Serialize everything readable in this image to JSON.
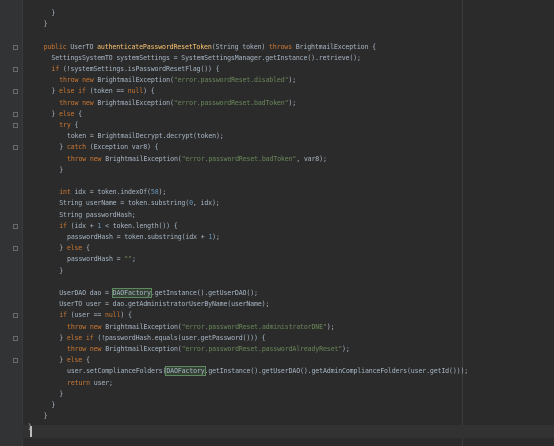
{
  "editor": {
    "background": "#2b2b2b",
    "language": "java",
    "lines": [
      {
        "indent": 6,
        "tokens": [
          {
            "t": "}",
            "c": "p"
          }
        ]
      },
      {
        "indent": 4,
        "tokens": [
          {
            "t": "}",
            "c": "p"
          }
        ]
      },
      {
        "indent": 0,
        "tokens": []
      },
      {
        "indent": 4,
        "tokens": [
          {
            "t": "public ",
            "c": "kw"
          },
          {
            "t": "UserTO ",
            "c": "p"
          },
          {
            "t": "authenticatePasswordResetToken",
            "c": "fn"
          },
          {
            "t": "(String token) ",
            "c": "p"
          },
          {
            "t": "throws ",
            "c": "kw"
          },
          {
            "t": "BrightmailException {",
            "c": "p"
          }
        ]
      },
      {
        "indent": 6,
        "tokens": [
          {
            "t": "SettingsSystemTO systemSettings = SystemSettingsManager.getInstance().retrieve();",
            "c": "p"
          }
        ]
      },
      {
        "indent": 6,
        "tokens": [
          {
            "t": "if ",
            "c": "kw"
          },
          {
            "t": "(!systemSettings.isPasswordResetFlag()) {",
            "c": "p"
          }
        ]
      },
      {
        "indent": 8,
        "tokens": [
          {
            "t": "throw new ",
            "c": "kw"
          },
          {
            "t": "BrightmailException(",
            "c": "p"
          },
          {
            "t": "\"error.passwordReset.disabled\"",
            "c": "str"
          },
          {
            "t": ");",
            "c": "p"
          }
        ]
      },
      {
        "indent": 6,
        "tokens": [
          {
            "t": "} ",
            "c": "p"
          },
          {
            "t": "else if ",
            "c": "kw"
          },
          {
            "t": "(token == ",
            "c": "p"
          },
          {
            "t": "null",
            "c": "kw"
          },
          {
            "t": ") {",
            "c": "p"
          }
        ]
      },
      {
        "indent": 8,
        "tokens": [
          {
            "t": "throw new ",
            "c": "kw"
          },
          {
            "t": "BrightmailException(",
            "c": "p"
          },
          {
            "t": "\"error.passwordReset.badToken\"",
            "c": "str"
          },
          {
            "t": ");",
            "c": "p"
          }
        ]
      },
      {
        "indent": 6,
        "tokens": [
          {
            "t": "} ",
            "c": "p"
          },
          {
            "t": "else ",
            "c": "kw"
          },
          {
            "t": "{",
            "c": "p"
          }
        ]
      },
      {
        "indent": 8,
        "tokens": [
          {
            "t": "try ",
            "c": "kw"
          },
          {
            "t": "{",
            "c": "p"
          }
        ]
      },
      {
        "indent": 10,
        "tokens": [
          {
            "t": "token = BrightmailDecrypt.decrypt(token);",
            "c": "p"
          }
        ]
      },
      {
        "indent": 8,
        "tokens": [
          {
            "t": "} ",
            "c": "p"
          },
          {
            "t": "catch ",
            "c": "kw"
          },
          {
            "t": "(Exception var8) {",
            "c": "p"
          }
        ]
      },
      {
        "indent": 10,
        "tokens": [
          {
            "t": "throw new ",
            "c": "kw"
          },
          {
            "t": "BrightmailException(",
            "c": "p"
          },
          {
            "t": "\"error.passwordReset.badToken\"",
            "c": "str"
          },
          {
            "t": ", var8);",
            "c": "p"
          }
        ]
      },
      {
        "indent": 8,
        "tokens": [
          {
            "t": "}",
            "c": "p"
          }
        ]
      },
      {
        "indent": 0,
        "tokens": []
      },
      {
        "indent": 8,
        "tokens": [
          {
            "t": "int ",
            "c": "kw"
          },
          {
            "t": "idx = token.indexOf(",
            "c": "p"
          },
          {
            "t": "58",
            "c": "num"
          },
          {
            "t": ");",
            "c": "p"
          }
        ]
      },
      {
        "indent": 8,
        "tokens": [
          {
            "t": "String userName = token.substring(",
            "c": "p"
          },
          {
            "t": "0",
            "c": "num"
          },
          {
            "t": ", idx);",
            "c": "p"
          }
        ]
      },
      {
        "indent": 8,
        "tokens": [
          {
            "t": "String passwordHash;",
            "c": "p"
          }
        ]
      },
      {
        "indent": 8,
        "tokens": [
          {
            "t": "if ",
            "c": "kw"
          },
          {
            "t": "(idx + ",
            "c": "p"
          },
          {
            "t": "1",
            "c": "num"
          },
          {
            "t": " < token.length()) {",
            "c": "p"
          }
        ]
      },
      {
        "indent": 10,
        "tokens": [
          {
            "t": "passwordHash = token.substring(idx + ",
            "c": "p"
          },
          {
            "t": "1",
            "c": "num"
          },
          {
            "t": ");",
            "c": "p"
          }
        ]
      },
      {
        "indent": 8,
        "tokens": [
          {
            "t": "} ",
            "c": "p"
          },
          {
            "t": "else ",
            "c": "kw"
          },
          {
            "t": "{",
            "c": "p"
          }
        ]
      },
      {
        "indent": 10,
        "tokens": [
          {
            "t": "passwordHash = ",
            "c": "p"
          },
          {
            "t": "\"\"",
            "c": "str"
          },
          {
            "t": ";",
            "c": "p"
          }
        ]
      },
      {
        "indent": 8,
        "tokens": [
          {
            "t": "}",
            "c": "p"
          }
        ]
      },
      {
        "indent": 0,
        "tokens": []
      },
      {
        "indent": 8,
        "tokens": [
          {
            "t": "UserDAO dao = ",
            "c": "p"
          },
          {
            "t": "DAOFactory",
            "c": "hl"
          },
          {
            "t": ".getInstance().getUserDAO();",
            "c": "p"
          }
        ]
      },
      {
        "indent": 8,
        "tokens": [
          {
            "t": "UserTO user = dao.getAdministratorUserByName(userName);",
            "c": "p"
          }
        ]
      },
      {
        "indent": 8,
        "tokens": [
          {
            "t": "if ",
            "c": "kw"
          },
          {
            "t": "(user == ",
            "c": "p"
          },
          {
            "t": "null",
            "c": "kw"
          },
          {
            "t": ") {",
            "c": "p"
          }
        ]
      },
      {
        "indent": 10,
        "tokens": [
          {
            "t": "throw new ",
            "c": "kw"
          },
          {
            "t": "BrightmailException(",
            "c": "p"
          },
          {
            "t": "\"error.passwordReset.administratorDNE\"",
            "c": "str"
          },
          {
            "t": ");",
            "c": "p"
          }
        ]
      },
      {
        "indent": 8,
        "tokens": [
          {
            "t": "} ",
            "c": "p"
          },
          {
            "t": "else if ",
            "c": "kw"
          },
          {
            "t": "(!passwordHash.equals(user.getPassword())) {",
            "c": "p"
          }
        ]
      },
      {
        "indent": 10,
        "tokens": [
          {
            "t": "throw new ",
            "c": "kw"
          },
          {
            "t": "BrightmailException(",
            "c": "p"
          },
          {
            "t": "\"error.passwordReset.passwordAlreadyReset\"",
            "c": "str"
          },
          {
            "t": ");",
            "c": "p"
          }
        ]
      },
      {
        "indent": 8,
        "tokens": [
          {
            "t": "} ",
            "c": "p"
          },
          {
            "t": "else ",
            "c": "kw"
          },
          {
            "t": "{",
            "c": "p"
          }
        ]
      },
      {
        "indent": 10,
        "tokens": [
          {
            "t": "user.setComplianceFolders(",
            "c": "p"
          },
          {
            "t": "DAOFactory",
            "c": "hl"
          },
          {
            "t": ".getInstance().getUserDAO().getAdminComplianceFolders(user.getId()));",
            "c": "p"
          }
        ]
      },
      {
        "indent": 10,
        "tokens": [
          {
            "t": "return ",
            "c": "kw"
          },
          {
            "t": "user;",
            "c": "p"
          }
        ]
      },
      {
        "indent": 8,
        "tokens": [
          {
            "t": "}",
            "c": "p"
          }
        ]
      },
      {
        "indent": 6,
        "tokens": [
          {
            "t": "}",
            "c": "p"
          }
        ]
      },
      {
        "indent": 4,
        "tokens": [
          {
            "t": "}",
            "c": "p"
          }
        ]
      },
      {
        "indent": 0,
        "tokens": [
          {
            "t": "}",
            "c": "p"
          }
        ]
      }
    ]
  }
}
